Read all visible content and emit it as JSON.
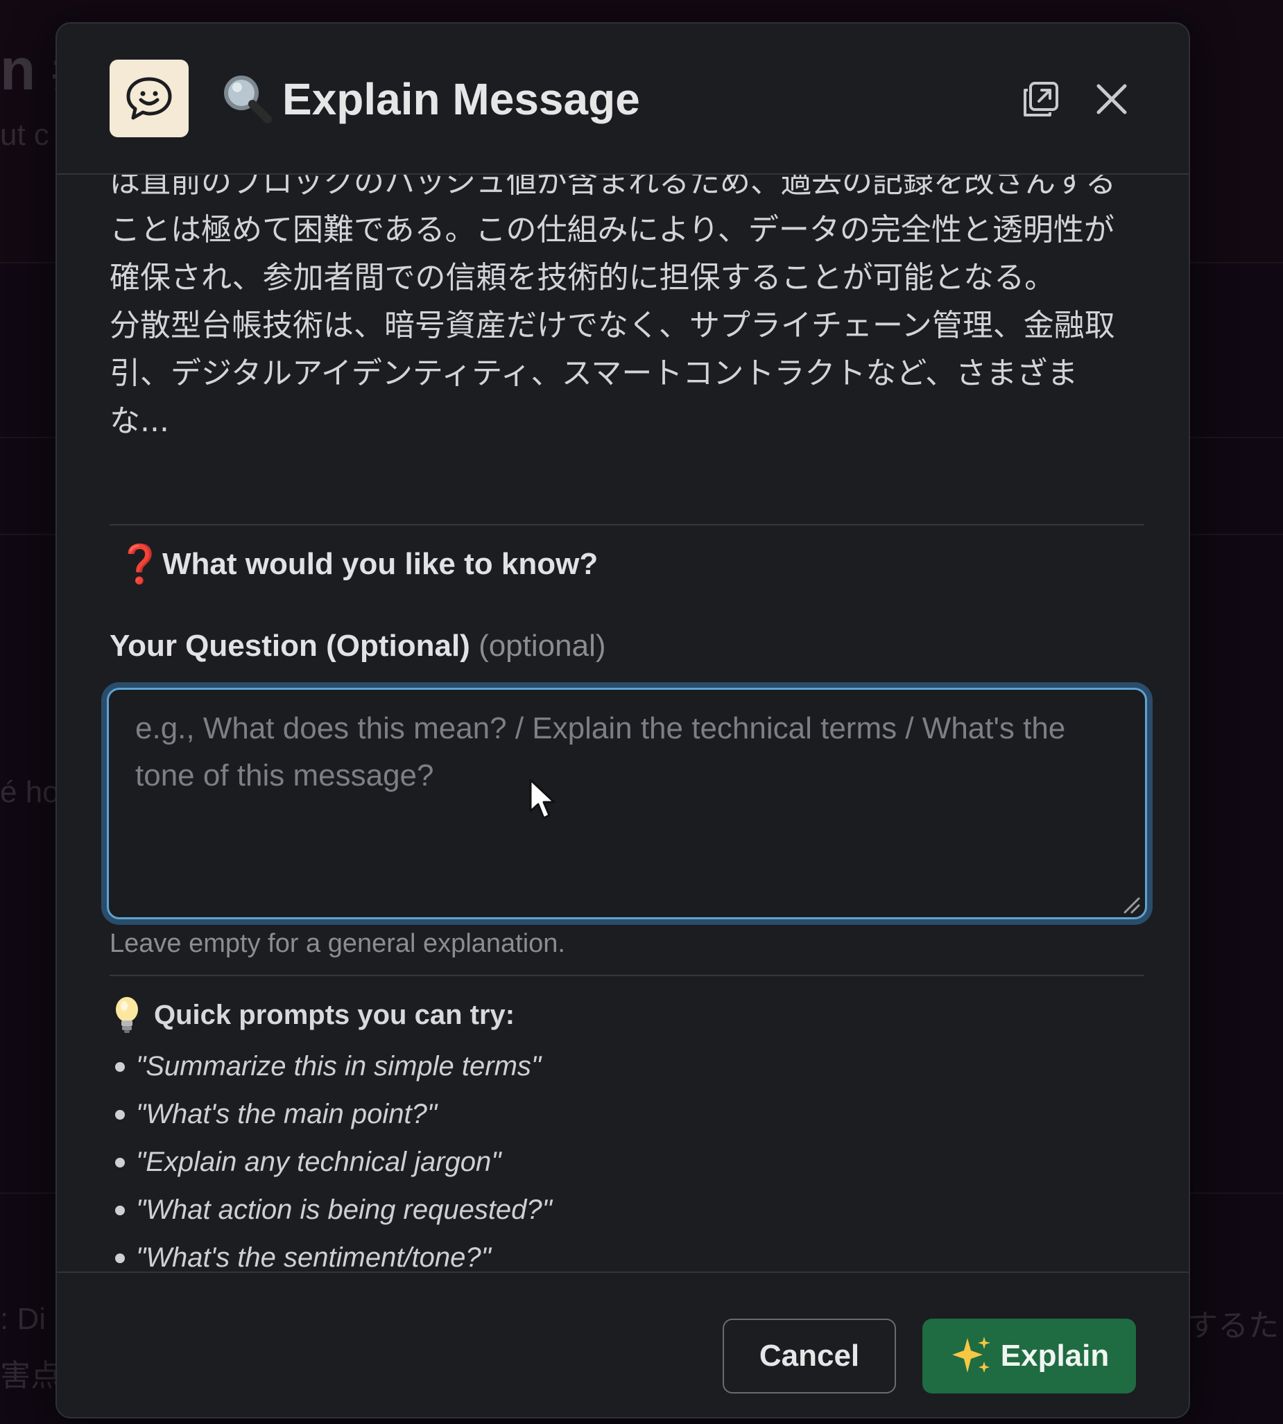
{
  "background": {
    "fragments": [
      "n #",
      "ut c",
      "é hoạ",
      ": Di",
      "害点",
      "するた"
    ]
  },
  "modal": {
    "title": "Explain Message",
    "title_emoji_icon": "magnifier-icon",
    "app_icon": "smiley-chat-icon",
    "header_actions": [
      "popout-icon",
      "close-icon"
    ],
    "message_paragraphs": [
      "は直前のブロックのハッシュ値が含まれるため、過去の記録を改ざんすることは極めて困難である。この仕組みにより、データの完全性と透明性が確保され、参加者間での信頼を技術的に担保することが可能となる。",
      "分散型台帳技術は、暗号資産だけでなく、サプライチェーン管理、金融取引、デジタルアイデンティティ、スマートコントラクトなど、さまざまな..."
    ],
    "question_section": {
      "heading_emoji": "❓",
      "heading": "What would you like to know?",
      "field_label": "Your Question (Optional)",
      "field_optional": "(optional)",
      "input_value": "",
      "input_placeholder": "e.g., What does this mean? / Explain the technical terms / What's the tone of this message?",
      "hint": "Leave empty for a general explanation."
    },
    "quick_prompts": {
      "heading_icon": "lightbulb-icon",
      "heading": "Quick prompts you can try:",
      "items": [
        "\"Summarize this in simple terms\"",
        "\"What's the main point?\"",
        "\"Explain any technical jargon\"",
        "\"What action is being requested?\"",
        "\"What's the sentiment/tone?\""
      ]
    },
    "footer": {
      "cancel_label": "Cancel",
      "explain_label": "Explain",
      "explain_icon": "sparkles-icon"
    }
  },
  "colors": {
    "modal_bg": "#1b1d21",
    "focus_ring": "#5fa3d0",
    "primary_button": "#1f6b42",
    "app_icon_bg": "#f4ead5"
  }
}
